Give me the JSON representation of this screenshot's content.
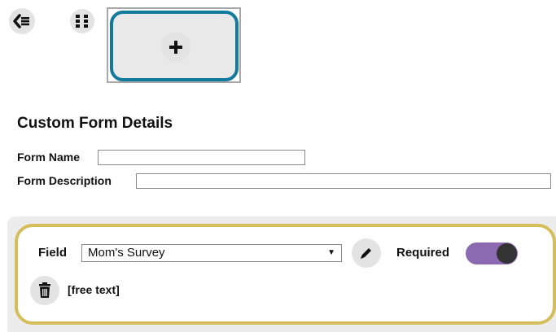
{
  "toolbar": {
    "back_icon": "chevron-left-list-icon",
    "grid_icon": "grid-dots-icon",
    "add_icon": "plus-icon"
  },
  "details": {
    "title": "Custom Form Details",
    "form_name_label": "Form Name",
    "form_name_value": "",
    "form_description_label": "Form Description",
    "form_description_value": ""
  },
  "field_panel": {
    "field_label": "Field",
    "field_selected": "Mom's Survey",
    "edit_icon": "pencil-icon",
    "required_label": "Required",
    "required_on": true,
    "delete_icon": "trash-icon",
    "field_type": "[free text]"
  },
  "colors": {
    "add_border": "#127a9c",
    "panel_border": "#d4be5c",
    "toggle_on": "#8c6ab2"
  }
}
